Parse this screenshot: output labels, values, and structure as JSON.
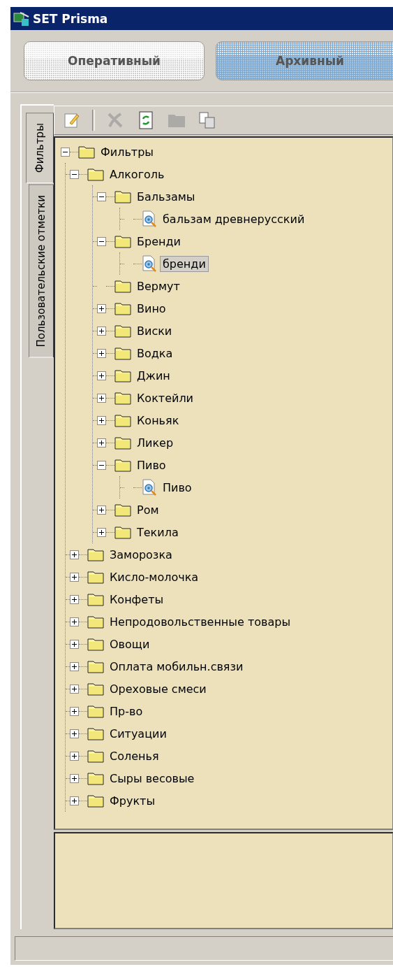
{
  "window": {
    "title": "SET Prisma"
  },
  "mode_buttons": [
    {
      "label": "Оперативный",
      "selected": false
    },
    {
      "label": "Архивный",
      "selected": true
    }
  ],
  "side_tabs": [
    {
      "label": "Фильтры",
      "selected": true
    },
    {
      "label": "Пользовательские отметки",
      "selected": false
    }
  ],
  "toolbar": [
    {
      "kind": "edit",
      "disabled": false
    },
    {
      "kind": "separator"
    },
    {
      "kind": "delete",
      "disabled": true
    },
    {
      "kind": "refresh",
      "disabled": false
    },
    {
      "kind": "folder",
      "disabled": true
    },
    {
      "kind": "copy",
      "disabled": false
    }
  ],
  "tree": [
    {
      "label": "Фильтры",
      "kind": "folder",
      "expanded": true,
      "selected": false,
      "children": [
        {
          "label": "Алкоголь",
          "kind": "folder",
          "expanded": true,
          "selected": false,
          "children": [
            {
              "label": "Бальзамы",
              "kind": "folder",
              "expanded": true,
              "selected": false,
              "children": [
                {
                  "label": "бальзам древнерусский",
                  "kind": "filter",
                  "selected": false
                }
              ]
            },
            {
              "label": "Бренди",
              "kind": "folder",
              "expanded": true,
              "selected": false,
              "children": [
                {
                  "label": "бренди",
                  "kind": "filter",
                  "selected": true
                }
              ]
            },
            {
              "label": "Вермут",
              "kind": "empty-folder",
              "selected": false
            },
            {
              "label": "Вино",
              "kind": "folder",
              "expanded": false,
              "selected": false
            },
            {
              "label": "Виски",
              "kind": "folder",
              "expanded": false,
              "selected": false
            },
            {
              "label": "Водка",
              "kind": "folder",
              "expanded": false,
              "selected": false
            },
            {
              "label": "Джин",
              "kind": "folder",
              "expanded": false,
              "selected": false
            },
            {
              "label": "Коктейли",
              "kind": "folder",
              "expanded": false,
              "selected": false
            },
            {
              "label": "Коньяк",
              "kind": "folder",
              "expanded": false,
              "selected": false
            },
            {
              "label": "Ликер",
              "kind": "folder",
              "expanded": false,
              "selected": false
            },
            {
              "label": "Пиво",
              "kind": "folder",
              "expanded": true,
              "selected": false,
              "children": [
                {
                  "label": "Пиво",
                  "kind": "filter",
                  "selected": false
                }
              ]
            },
            {
              "label": "Ром",
              "kind": "folder",
              "expanded": false,
              "selected": false
            },
            {
              "label": "Текила",
              "kind": "folder",
              "expanded": false,
              "selected": false
            }
          ]
        },
        {
          "label": "Заморозка",
          "kind": "folder",
          "expanded": false,
          "selected": false
        },
        {
          "label": "Кисло-молочка",
          "kind": "folder",
          "expanded": false,
          "selected": false
        },
        {
          "label": "Конфеты",
          "kind": "folder",
          "expanded": false,
          "selected": false
        },
        {
          "label": "Непродовольственные товары",
          "kind": "folder",
          "expanded": false,
          "selected": false
        },
        {
          "label": "Овощи",
          "kind": "folder",
          "expanded": false,
          "selected": false
        },
        {
          "label": "Оплата мобильн.связи",
          "kind": "folder",
          "expanded": false,
          "selected": false
        },
        {
          "label": "Ореховые смеси",
          "kind": "folder",
          "expanded": false,
          "selected": false
        },
        {
          "label": "Пр-во",
          "kind": "folder",
          "expanded": false,
          "selected": false
        },
        {
          "label": "Ситуации",
          "kind": "folder",
          "expanded": false,
          "selected": false
        },
        {
          "label": "Соленья",
          "kind": "folder",
          "expanded": false,
          "selected": false
        },
        {
          "label": "Сыры весовые",
          "kind": "folder",
          "expanded": false,
          "selected": false
        },
        {
          "label": "Фрукты",
          "kind": "folder",
          "expanded": false,
          "selected": false
        }
      ]
    }
  ]
}
